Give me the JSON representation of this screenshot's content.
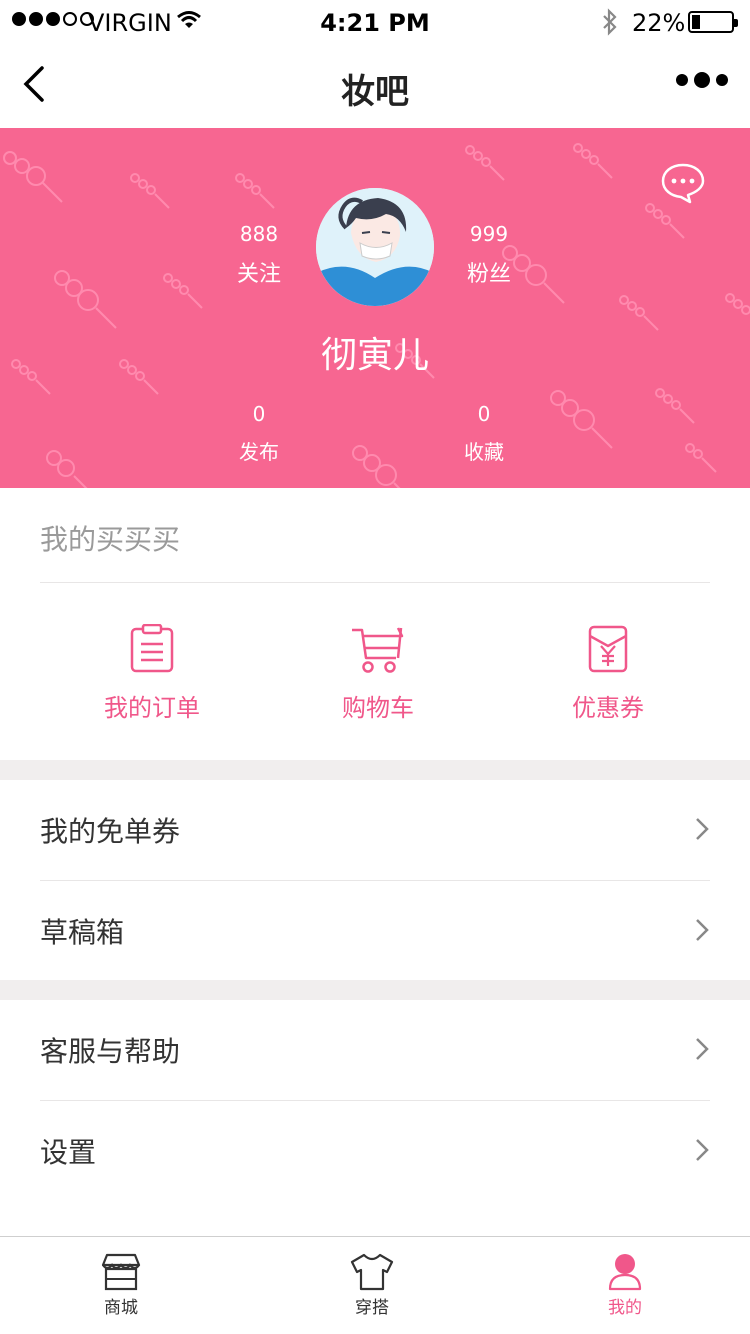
{
  "status_bar": {
    "carrier": "VIRGIN",
    "time": "4:21 PM",
    "battery": "22%",
    "battery_level": 0.22
  },
  "nav": {
    "title": "妆吧",
    "back_icon": "chevron-left-icon",
    "more_icon": "more-dots-icon"
  },
  "profile": {
    "following_count": "888",
    "following_label": "关注",
    "followers_count": "999",
    "followers_label": "粉丝",
    "username": "彻寅儿",
    "posts_count": "0",
    "posts_label": "发布",
    "favorites_count": "0",
    "favorites_label": "收藏",
    "header_color": "#f76691"
  },
  "shopping": {
    "title": "我的买买买",
    "items": [
      {
        "label": "我的订单",
        "icon": "order-list-icon"
      },
      {
        "label": "购物车",
        "icon": "shopping-cart-icon"
      },
      {
        "label": "优惠券",
        "icon": "coupon-yen-icon"
      }
    ],
    "accent_color": "#f0578a"
  },
  "menu": {
    "group1": [
      "我的免单券",
      "草稿箱"
    ],
    "group2": [
      "客服与帮助",
      "设置"
    ]
  },
  "tabbar": {
    "tabs": [
      {
        "label": "商城",
        "icon": "store-icon"
      },
      {
        "label": "穿搭",
        "icon": "tshirt-icon"
      },
      {
        "label": "我的",
        "icon": "user-icon"
      }
    ],
    "active": "我的"
  }
}
